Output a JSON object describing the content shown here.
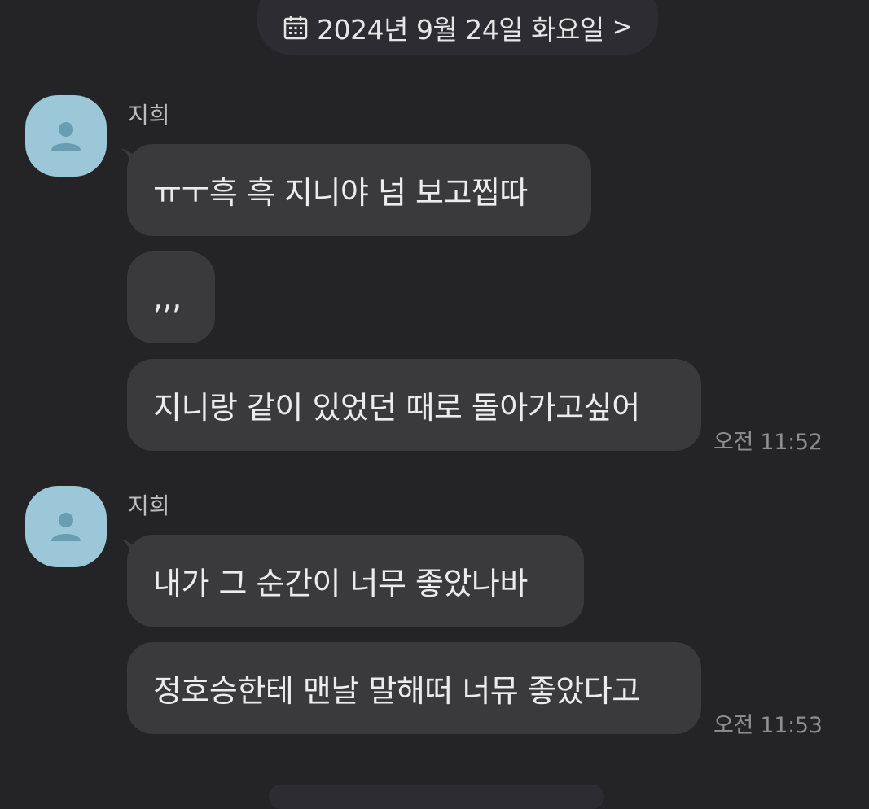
{
  "date_divider": {
    "label": "2024년 9월 24일 화요일",
    "calendar_icon": "calendar-icon",
    "chevron_icon": "chevron-right-icon",
    "chevron": ">"
  },
  "colors": {
    "background": "#242427",
    "bubble": "#3a3a3d",
    "avatar": "#9bc7d8",
    "avatar_silhouette": "#6a9db2"
  },
  "groups": [
    {
      "sender": "지희",
      "avatar_icon": "person-icon",
      "messages": [
        "ㅠㅜ흑 흑 지니야 넘 보고찝따",
        ",,,",
        "지니랑 같이 있었던 때로 돌아가고싶어"
      ],
      "time": "오전 11:52"
    },
    {
      "sender": "지희",
      "avatar_icon": "person-icon",
      "messages": [
        "내가 그 순간이 너무 좋았나바",
        "정호승한테 맨날 말해떠 너뮤 좋았다고"
      ],
      "time": "오전 11:53"
    }
  ]
}
